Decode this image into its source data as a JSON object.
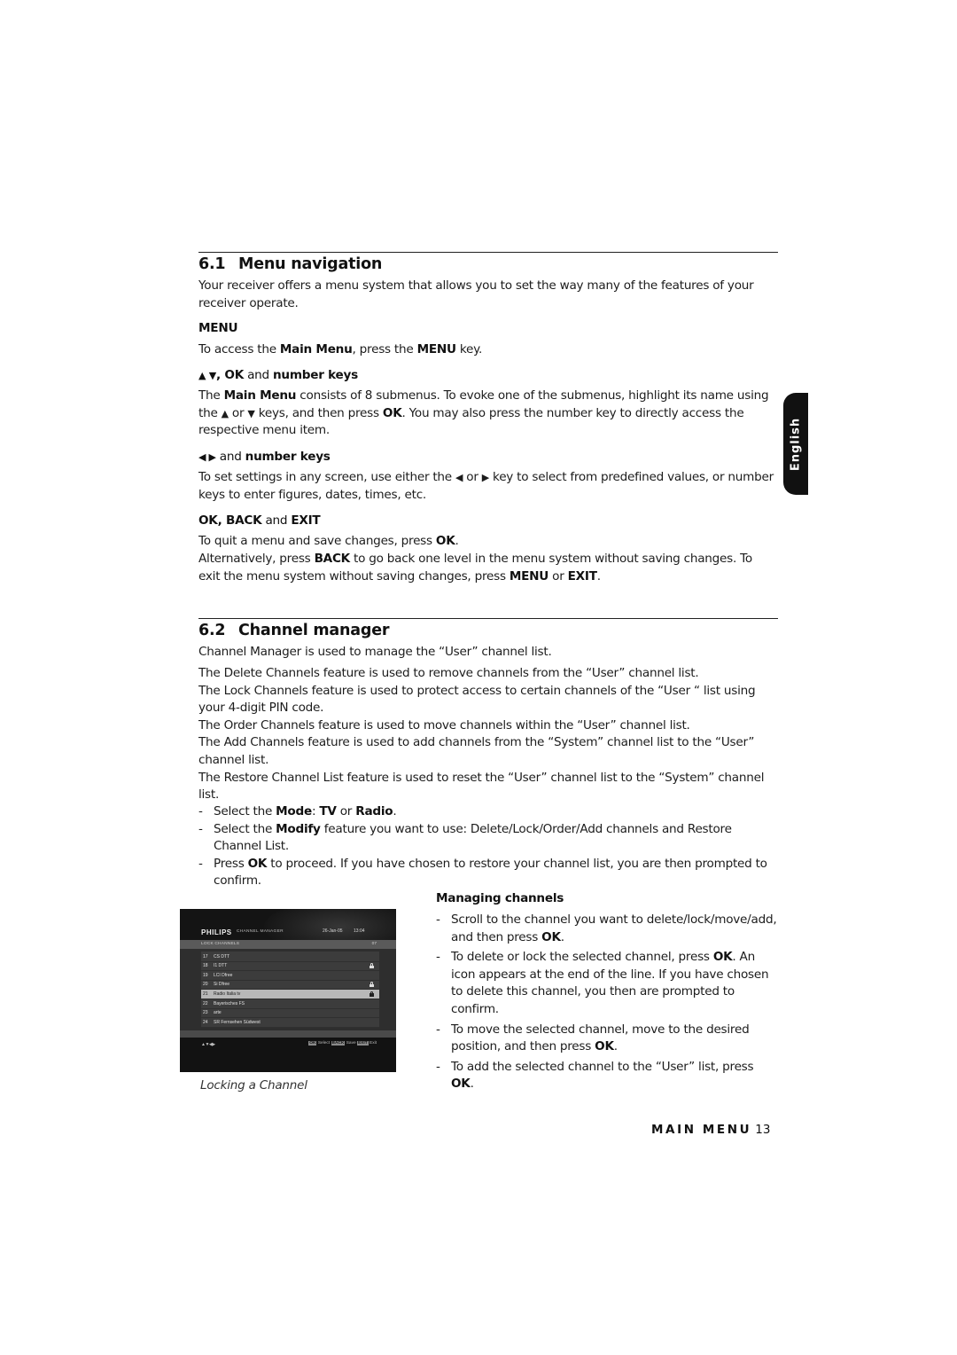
{
  "side_tab": {
    "label": "English"
  },
  "section_61": {
    "number": "6.1",
    "title": "Menu navigation",
    "intro": "Your receiver offers a menu system that allows you to set the way many of the features of your receiver operate.",
    "menu": {
      "heading": "MENU",
      "text": [
        "To access the ",
        "Main Menu",
        ", press the ",
        "MENU",
        " key."
      ]
    },
    "updown": {
      "heading_sym": "▲ ▼",
      "heading_parts": [
        ", ",
        "OK",
        " and ",
        "number keys"
      ],
      "text": [
        "The ",
        "Main Menu",
        " consists of 8 submenus. To evoke one of the submenus, highlight its name using the ",
        "▲",
        " or ",
        "▼",
        " keys, and then press ",
        "OK",
        ". You may also press the number key to directly access the respective menu item."
      ]
    },
    "leftright": {
      "heading_sym": "◀ ▶",
      "heading_parts": [
        " and ",
        "number keys"
      ],
      "text": [
        "To set settings in any screen, use either the ",
        "◀",
        " or ",
        "▶",
        " key to select from predefined values, or number keys to enter figures, dates, times, etc."
      ]
    },
    "okbackexit": {
      "heading_parts": [
        "OK, BACK",
        " and ",
        "EXIT"
      ],
      "line1": [
        "To quit a menu and save changes, press ",
        "OK",
        "."
      ],
      "line2": [
        "Alternatively, press ",
        "BACK",
        " to go back one level in the menu system without saving changes. To exit the menu system without saving changes, press ",
        "MENU",
        " or ",
        "EXIT",
        "."
      ]
    }
  },
  "section_62": {
    "number": "6.2",
    "title": "Channel manager",
    "intro": "Channel Manager is used to manage the “User” channel list.",
    "features": [
      "The Delete Channels feature is used to remove channels from the “User” channel list.",
      "The Lock Channels feature is used to protect access to certain channels of the “User “ list using your 4-digit PIN code.",
      "The Order Channels feature is used to move channels within the “User” channel list.",
      "The Add Channels feature is used to add channels from the “System” channel list to the “User” channel list.",
      "The Restore Channel List feature is used to reset the “User” channel list to the “System” channel list."
    ],
    "steps": {
      "s1": [
        "Select the ",
        "Mode",
        ": ",
        "TV",
        " or ",
        "Radio",
        "."
      ],
      "s2": [
        "Select the ",
        "Modify",
        " feature you want to use: Delete/Lock/Order/Add channels and Restore Channel List."
      ],
      "s3": [
        "Press ",
        "OK",
        " to proceed. If you have chosen to restore your channel list, you are then prompted to confirm."
      ]
    },
    "managing": {
      "heading": "Managing channels",
      "m1": [
        "Scroll to the channel you want to delete/lock/move/add, and then press ",
        "OK",
        "."
      ],
      "m2": [
        "To delete or lock the selected channel, press ",
        "OK",
        ". An icon appears at the end of the line. If you have chosen to delete this channel, you then are prompted to confirm."
      ],
      "m3": [
        "To move the selected channel, move to the desired position, and then press ",
        "OK",
        "."
      ],
      "m4": [
        "To add the selected channel to the “User” list, press ",
        "OK",
        "."
      ]
    }
  },
  "tv_screen": {
    "brand": "PHILIPS",
    "section": "CHANNEL MANAGER",
    "date": "26-Jan-05",
    "time": "13:04",
    "list_title": "LOCK CHANNELS",
    "count": "07",
    "channels": [
      {
        "no": "17",
        "name": "CS DTT",
        "locked": false,
        "selected": false
      },
      {
        "no": "18",
        "name": "I1 DTT",
        "locked": true,
        "selected": false
      },
      {
        "no": "19",
        "name": "LCI Dfree",
        "locked": false,
        "selected": false
      },
      {
        "no": "20",
        "name": "Si Dfree",
        "locked": true,
        "selected": false
      },
      {
        "no": "21",
        "name": "Radio Italia tv",
        "locked": true,
        "selected": true
      },
      {
        "no": "22",
        "name": "Bayerisches FS",
        "locked": false,
        "selected": false
      },
      {
        "no": "23",
        "name": "arte",
        "locked": false,
        "selected": false
      },
      {
        "no": "24",
        "name": "SR Fernsehen Südwest",
        "locked": false,
        "selected": false
      }
    ],
    "nav_hint": "▲▼◀▶",
    "keys": [
      {
        "key": "OK",
        "action": "Select"
      },
      {
        "key": "BACK",
        "action": "Save"
      },
      {
        "key": "EXIT",
        "action": "Exit"
      }
    ]
  },
  "caption": "Locking a Channel",
  "footer": {
    "section": "MAIN MENU",
    "page": "13"
  }
}
